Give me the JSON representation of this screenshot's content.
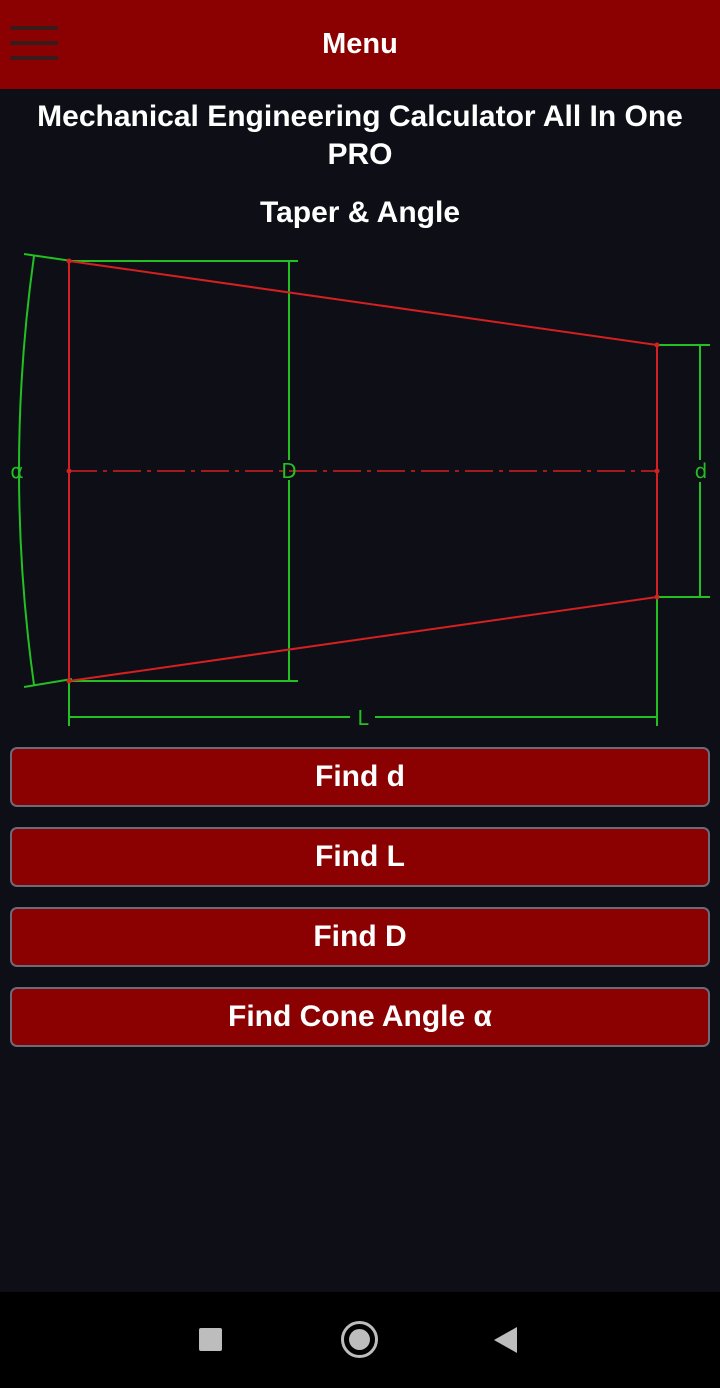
{
  "header": {
    "title": "Menu",
    "menu_icon": "hamburger-icon"
  },
  "app_title": "Mechanical Engineering Calculator All In One PRO",
  "section_title": "Taper & Angle",
  "diagram": {
    "labels": {
      "alpha": "α",
      "big_d": "D",
      "small_d": "d",
      "length": "L"
    },
    "colors": {
      "shape": "#d42020",
      "dimension": "#22c022",
      "background": "#0e0e17"
    }
  },
  "buttons": [
    {
      "label": "Find d"
    },
    {
      "label": "Find L"
    },
    {
      "label": "Find D"
    },
    {
      "label": "Find Cone Angle α"
    }
  ],
  "nav": {
    "recents_icon": "square-icon",
    "home_icon": "circle-icon",
    "back_icon": "triangle-back-icon"
  },
  "colors": {
    "accent": "#8b0000",
    "background": "#0e0e17"
  }
}
